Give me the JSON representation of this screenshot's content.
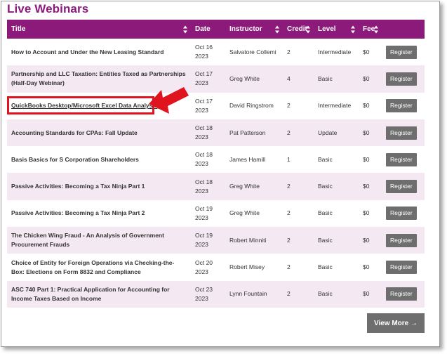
{
  "page": {
    "heading": "Live Webinars"
  },
  "table": {
    "headers": {
      "title": "Title",
      "date": "Date",
      "instructor": "Instructor",
      "credit": "Credit",
      "level": "Level",
      "fee": "Fee"
    },
    "rows": [
      {
        "title": "How to Account and Under the New Leasing Standard",
        "date": "Oct 16 2023",
        "instructor": "Salvatore Collemi",
        "credit": "2",
        "level": "Intermediate",
        "fee": "$0",
        "button": "Register"
      },
      {
        "title": "Partnership and LLC Taxation: Entities Taxed as Partnerships (Half-Day Webinar)",
        "date": "Oct 17 2023",
        "instructor": "Greg White",
        "credit": "4",
        "level": "Basic",
        "fee": "$0",
        "button": "Register"
      },
      {
        "title": "QuickBooks Desktop/Microsoft Excel Data Analysis",
        "date": "Oct 17 2023",
        "instructor": "David Ringstrom",
        "credit": "2",
        "level": "Intermediate",
        "fee": "$0",
        "button": "Register"
      },
      {
        "title": "Accounting Standards for CPAs: Fall Update",
        "date": "Oct 18 2023",
        "instructor": "Pat Patterson",
        "credit": "2",
        "level": "Update",
        "fee": "$0",
        "button": "Register"
      },
      {
        "title": "Basis Basics for S Corporation Shareholders",
        "date": "Oct 18 2023",
        "instructor": "James Hamill",
        "credit": "1",
        "level": "Basic",
        "fee": "$0",
        "button": "Register"
      },
      {
        "title": "Passive Activities: Becoming a Tax Ninja Part 1",
        "date": "Oct 18 2023",
        "instructor": "Greg White",
        "credit": "2",
        "level": "Basic",
        "fee": "$0",
        "button": "Register"
      },
      {
        "title": "Passive Activities: Becoming a Tax Ninja Part 2",
        "date": "Oct 19 2023",
        "instructor": "Greg White",
        "credit": "2",
        "level": "Basic",
        "fee": "$0",
        "button": "Register"
      },
      {
        "title": "The Chicken Wing Fraud - An Analysis of Government Procurement Frauds",
        "date": "Oct 19 2023",
        "instructor": "Robert Minniti",
        "credit": "2",
        "level": "Basic",
        "fee": "$0",
        "button": "Register"
      },
      {
        "title": "Choice of Entity for Foreign Operations via Checking-the-Box: Elections on Form 8832 and Compliance",
        "date": "Oct 20 2023",
        "instructor": "Robert Misey",
        "credit": "2",
        "level": "Basic",
        "fee": "$0",
        "button": "Register"
      },
      {
        "title": "ASC 740 Part 1: Practical Application for Accounting for Income Taxes Based on Income",
        "date": "Oct 23 2023",
        "instructor": "Lynn Fountain",
        "credit": "2",
        "level": "Basic",
        "fee": "$0",
        "button": "Register"
      }
    ]
  },
  "view_more": "View More →",
  "colors": {
    "accent": "#8b1a7a",
    "button": "#6e6e6e",
    "highlight": "#e0141e",
    "row_alt": "#f4e8f2"
  }
}
